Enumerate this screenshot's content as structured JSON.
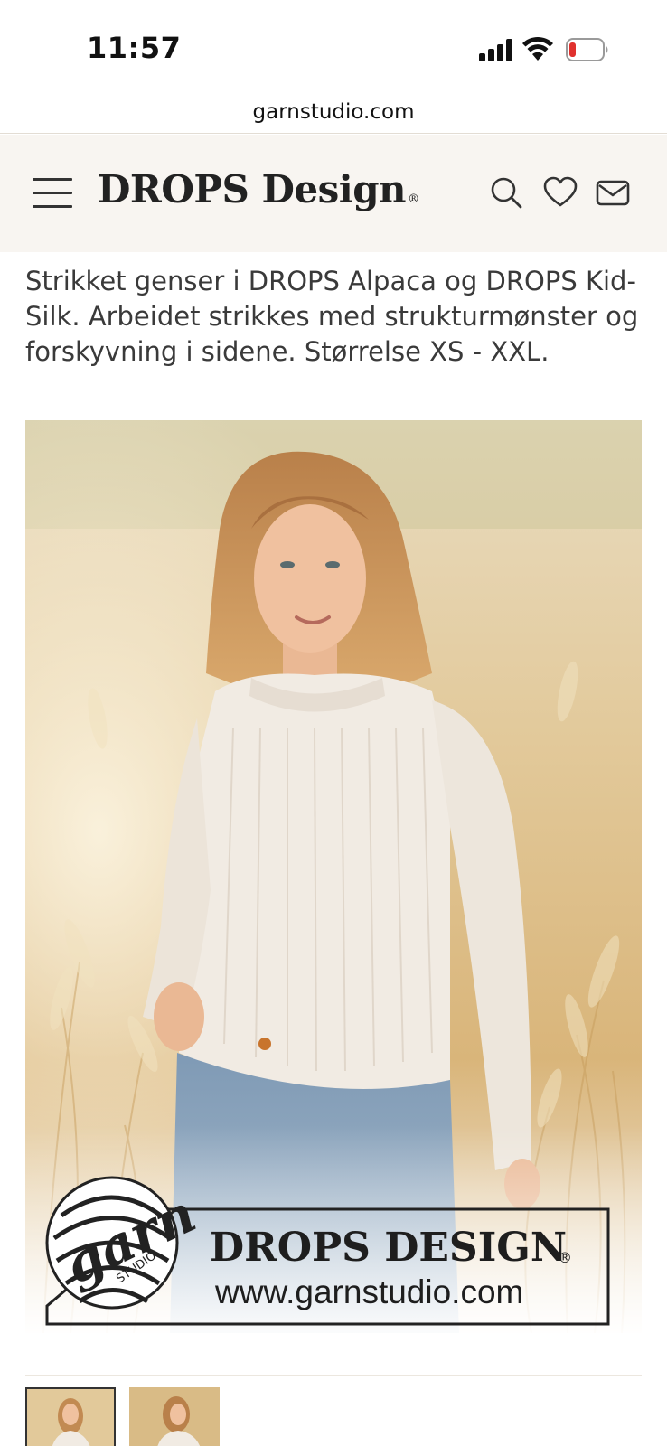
{
  "status_bar": {
    "time": "11:57"
  },
  "browser": {
    "url": "garnstudio.com"
  },
  "header": {
    "brand": "DROPS Design",
    "brand_mark": "®"
  },
  "product": {
    "description": "Strikket genser i DROPS Alpaca og DROPS Kid-Silk. Arbeidet strikkes med strukturmønster og forskyvning i sidene. Størrelse XS - XXL."
  },
  "watermark": {
    "logo_text": "garn",
    "logo_subtext": "STUDIO",
    "title": "DROPS DESIGN",
    "title_mark": "®",
    "url": "www.garnstudio.com"
  },
  "thumbnails": [
    {
      "selected": true
    },
    {
      "selected": false
    }
  ],
  "colors": {
    "header_bg": "#f8f5f1",
    "battery_low": "#e0312e",
    "text": "#3a3a3a"
  }
}
